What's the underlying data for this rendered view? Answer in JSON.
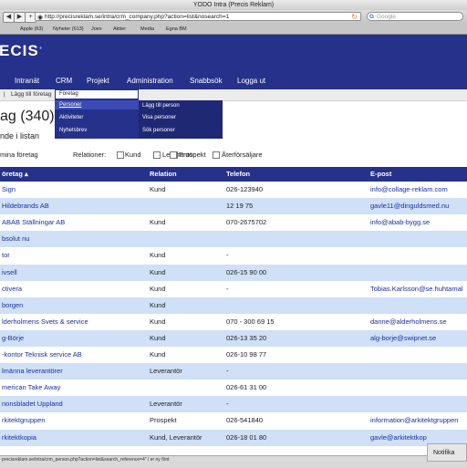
{
  "window": {
    "title": "YODO Intra (Precis Reklam)"
  },
  "browser": {
    "back": "◀",
    "forward": "▶",
    "add": "+",
    "url": "http://precisreklam.se/intra/crm_company.php?action=list&nosearch=1",
    "search_placeholder": "Google",
    "bookmarks": [
      "Apple (63)",
      "Nyheter (613)",
      "Joes",
      "Aktier",
      "Media",
      "Egna BM"
    ]
  },
  "site": {
    "logo": "ECIS",
    "nav": [
      "Intranät",
      "CRM",
      "Projekt",
      "Administration",
      "Snabbsök",
      "Logga ut"
    ],
    "subnav": [
      "Lägg till företag"
    ],
    "crm_menu": {
      "col1": [
        "Företag",
        "Personer",
        "Aktiviteter",
        "Nyhetsbrev"
      ],
      "col2": [
        "Lägg till person",
        "Visa personer",
        "Sök personer"
      ]
    }
  },
  "page": {
    "heading": "ag (340)",
    "subheading": "nde i listan",
    "filter_label": "mina företag",
    "relations_label": "Relationer:",
    "relation_options": [
      "Kund",
      "Leverantör",
      "Prospekt",
      "Återförsäljare"
    ]
  },
  "table": {
    "columns": [
      "öretag ▴",
      "Relation",
      "Telefon",
      "E-post"
    ],
    "rows": [
      {
        "company": "Sign",
        "relation": "Kund",
        "phone": "026-123940",
        "email": "info@collage-reklam.com"
      },
      {
        "company": " Hildebrands AB",
        "relation": "",
        "phone": "12 19 75",
        "email": "gavle11@dinguldsmed.nu"
      },
      {
        "company": "ABAB Ställningar AB",
        "relation": "Kund",
        "phone": "070-2675702",
        "email": "info@abab-bygg.se"
      },
      {
        "company": "bsolut nu",
        "relation": "",
        "phone": "",
        "email": ""
      },
      {
        "company": "tor",
        "relation": "Kund",
        "phone": "-",
        "email": ""
      },
      {
        "company": "ivsell",
        "relation": "Kund",
        "phone": "026-15 90 00",
        "email": ""
      },
      {
        "company": "ctivera",
        "relation": "Kund",
        "phone": "-",
        "email": "Tobias.Karlsson@se.huhtamal"
      },
      {
        "company": "borgen",
        "relation": "Kund",
        "phone": "",
        "email": ""
      },
      {
        "company": "lderholmens Svets & service",
        "relation": "Kund",
        "phone": "070 - 300 69 15",
        "email": "danne@alderholmens.se"
      },
      {
        "company": "g-Börje",
        "relation": "Kund",
        "phone": "026-13 35 20",
        "email": "alg-borje@swipnet.se"
      },
      {
        "company": "-kontor Teknisk service AB",
        "relation": "Kund",
        "phone": "026-10 98 77",
        "email": ""
      },
      {
        "company": "lmänna leverantörer",
        "relation": "Leverantör",
        "phone": "-",
        "email": ""
      },
      {
        "company": "merican Take Away",
        "relation": "",
        "phone": "026-61 31 00",
        "email": ""
      },
      {
        "company": "nonsbladet Uppland",
        "relation": "Leverantör",
        "phone": "-",
        "email": ""
      },
      {
        "company": "rkitektgruppen",
        "relation": "Prospekt",
        "phone": "026-541840",
        "email": "information@arkitektgruppen"
      },
      {
        "company": "rkitektkopia",
        "relation": "Kund, Leverantör",
        "phone": "026-18 01 80",
        "email": "gavle@arkitektkop"
      }
    ]
  },
  "status": {
    "text": "precisreklam.se/intra/crm_person.php?action=list&search_reference=4\" / er ny fönt",
    "notification": "Notifika"
  }
}
